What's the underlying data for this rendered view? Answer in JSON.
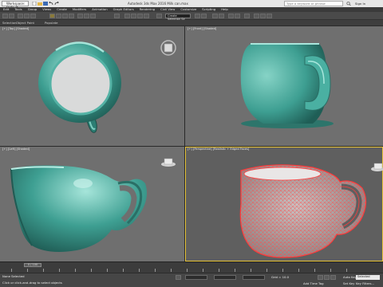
{
  "titlebar": {
    "workspace": "Workspace: Default",
    "title": "Autodesk 3ds Max 2016     Milk can.max",
    "search_placeholder": "Type a keyword or phrase",
    "signin": "Sign In"
  },
  "menubar": [
    "Edit",
    "Tools",
    "Group",
    "Views",
    "Create",
    "Modifiers",
    "Animation",
    "Graph Editors",
    "Rendering",
    "Civil View",
    "Customize",
    "Scripting",
    "Help"
  ],
  "toolbar": {
    "selection_set": "Create Selection Se"
  },
  "ribbon": {
    "tabs": [
      "Selection",
      "Object Paint",
      "Populate"
    ]
  },
  "viewports": {
    "top_label": "[+] [Top] [Shaded]",
    "front_label": "[+] [Front] [Shaded]",
    "left_label": "[+] [Left] [Shaded]",
    "persp_label": "[+] [Perspective] [Realistic + Edged Faces]"
  },
  "timeline": {
    "frame_label": "0 / 100"
  },
  "statusbar": {
    "selection_status": "None Selected",
    "prompt": "Click or click-and-drag to select objects",
    "grid": "Grid = 10.0",
    "autokey": "Auto Key",
    "setkey": "Set Key",
    "add_time_tag": "Add Time Tag",
    "key_filters": "Key Filters...",
    "selected": "Selected"
  },
  "colors": {
    "object": "#3e9f92",
    "wire": "#ff3a3a",
    "active_border": "#e9c53a"
  }
}
